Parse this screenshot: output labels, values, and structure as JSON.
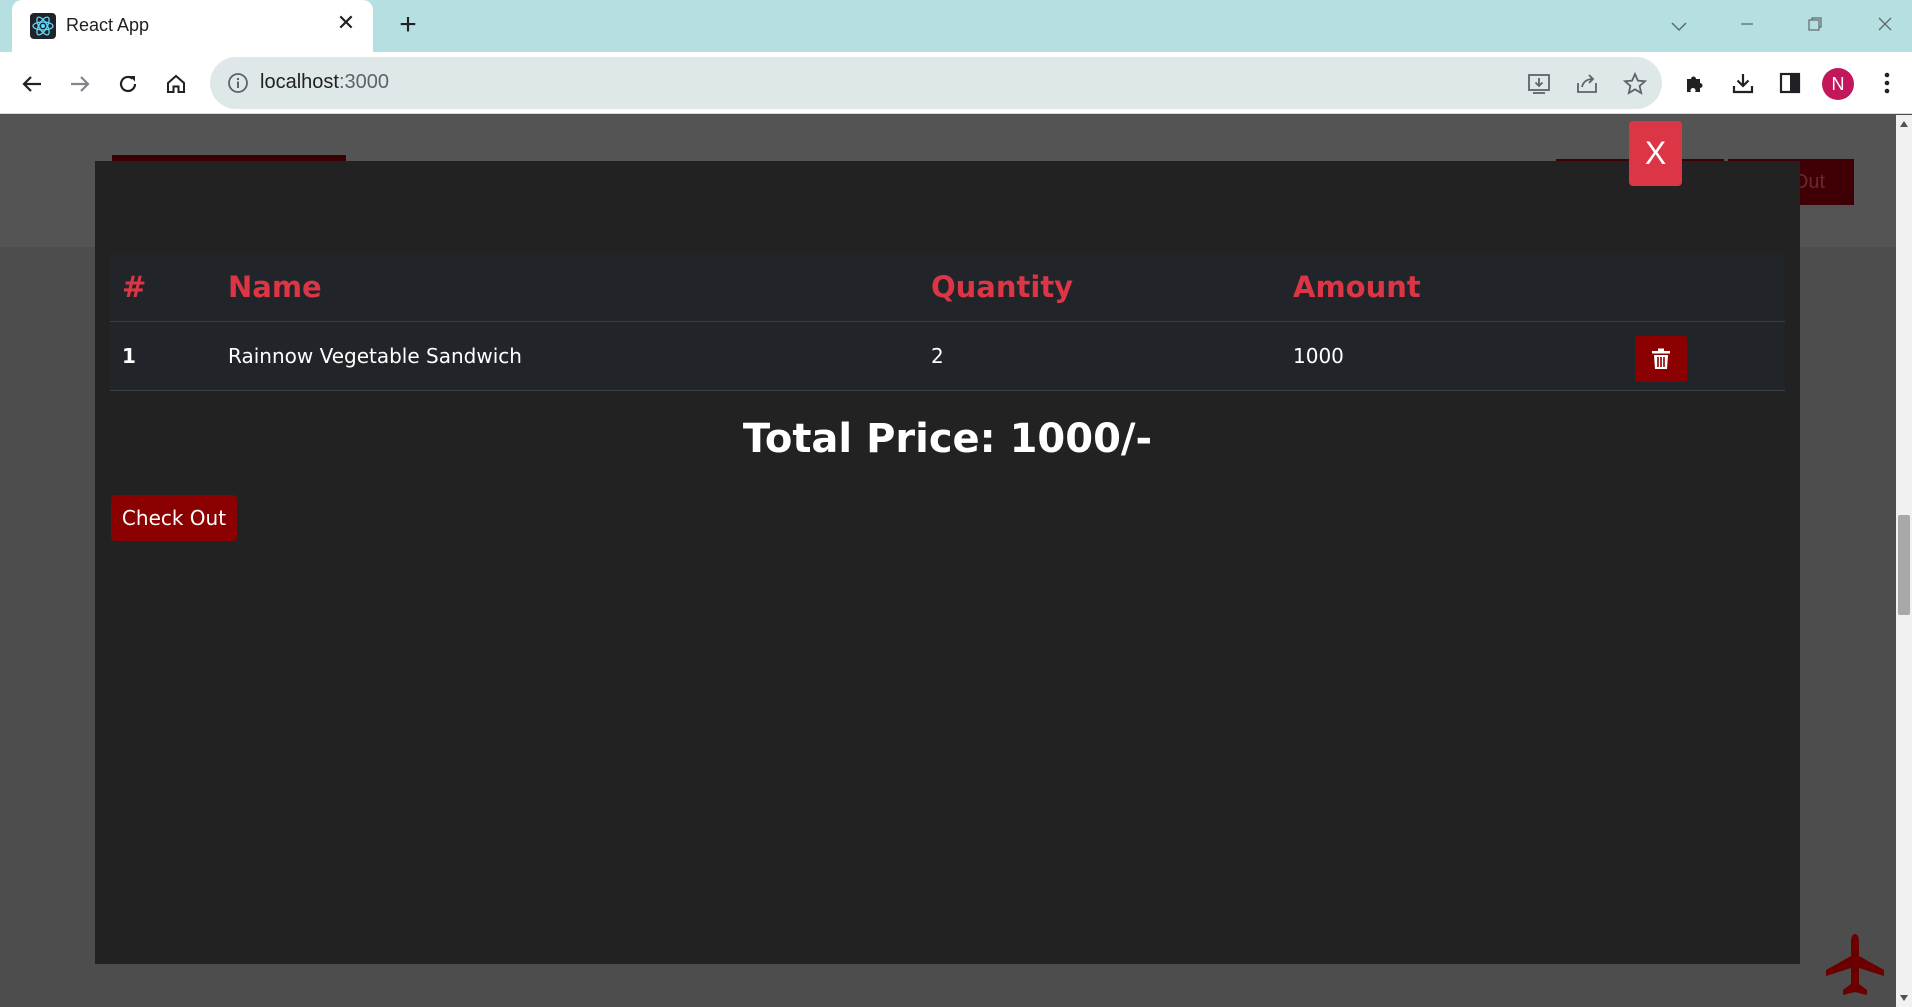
{
  "browser": {
    "tab_title": "React App",
    "tab_close": "✕",
    "new_tab": "+",
    "url_host": "localhost",
    "url_port": ":3000",
    "profile_initial": "N"
  },
  "background": {
    "button_right_label": "Out"
  },
  "modal": {
    "close_label": "X",
    "columns": {
      "index": "#",
      "name": "Name",
      "quantity": "Quantity",
      "amount": "Amount"
    },
    "rows": [
      {
        "index": "1",
        "name": "Rainnow Vegetable Sandwich",
        "quantity": "2",
        "amount": "1000"
      }
    ],
    "total_text": "Total Price: 1000/-",
    "checkout_label": "Check Out"
  },
  "colors": {
    "accent": "#dc3545",
    "button_dark_red": "#8b0000",
    "modal_bg": "#222222",
    "table_bg": "#212529"
  },
  "icons": [
    "react-favicon",
    "back-arrow-icon",
    "forward-arrow-icon",
    "reload-icon",
    "home-icon",
    "info-icon",
    "install-icon",
    "share-icon",
    "star-icon",
    "extensions-icon",
    "download-icon",
    "sidepanel-icon",
    "menu-icon",
    "trash-icon",
    "plane-icon"
  ]
}
